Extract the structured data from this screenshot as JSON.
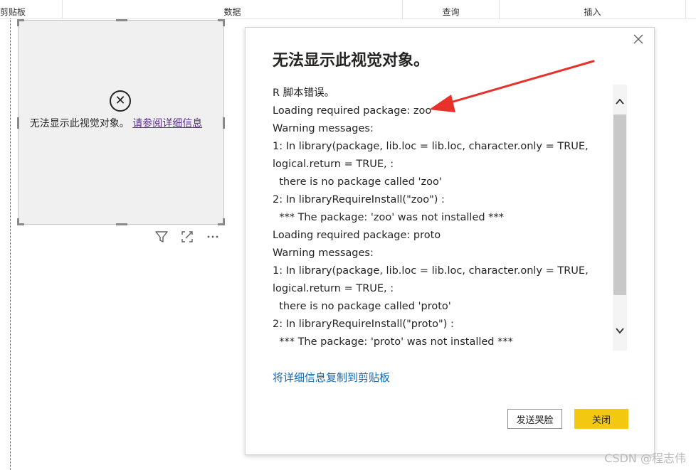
{
  "ribbon": {
    "groups": [
      "剪贴板",
      "数据",
      "查询",
      "插入"
    ]
  },
  "visual": {
    "message": "无法显示此视觉对象。",
    "link": "请参阅详细信息",
    "actions": [
      "filter-icon",
      "focus-mode-icon",
      "more-options-icon"
    ]
  },
  "dialog": {
    "title": "无法显示此视觉对象。",
    "lines": [
      "R 脚本错误。",
      "Loading required package: zoo",
      "Warning messages:",
      "1: In library(package, lib.loc = lib.loc, character.only = TRUE,",
      "logical.return = TRUE, :",
      "  there is no package called 'zoo'",
      "2: In libraryRequireInstall(\"zoo\") :",
      "  *** The package: 'zoo' was not installed ***",
      "Loading required package: proto",
      "Warning messages:",
      "1: In library(package, lib.loc = lib.loc, character.only = TRUE,",
      "logical.return = TRUE, :",
      "  there is no package called 'proto'",
      "2: In libraryRequireInstall(\"proto\") :",
      "  *** The package: 'proto' was not installed ***"
    ],
    "copy_link": "将详细信息复制到剪贴板",
    "frown_button": "发送哭脸",
    "close_button": "关闭"
  },
  "watermark": "CSDN @程志伟",
  "colors": {
    "accent_button": "#f2c811",
    "link": "#1068b5",
    "annotation_arrow": "#e8312b"
  }
}
